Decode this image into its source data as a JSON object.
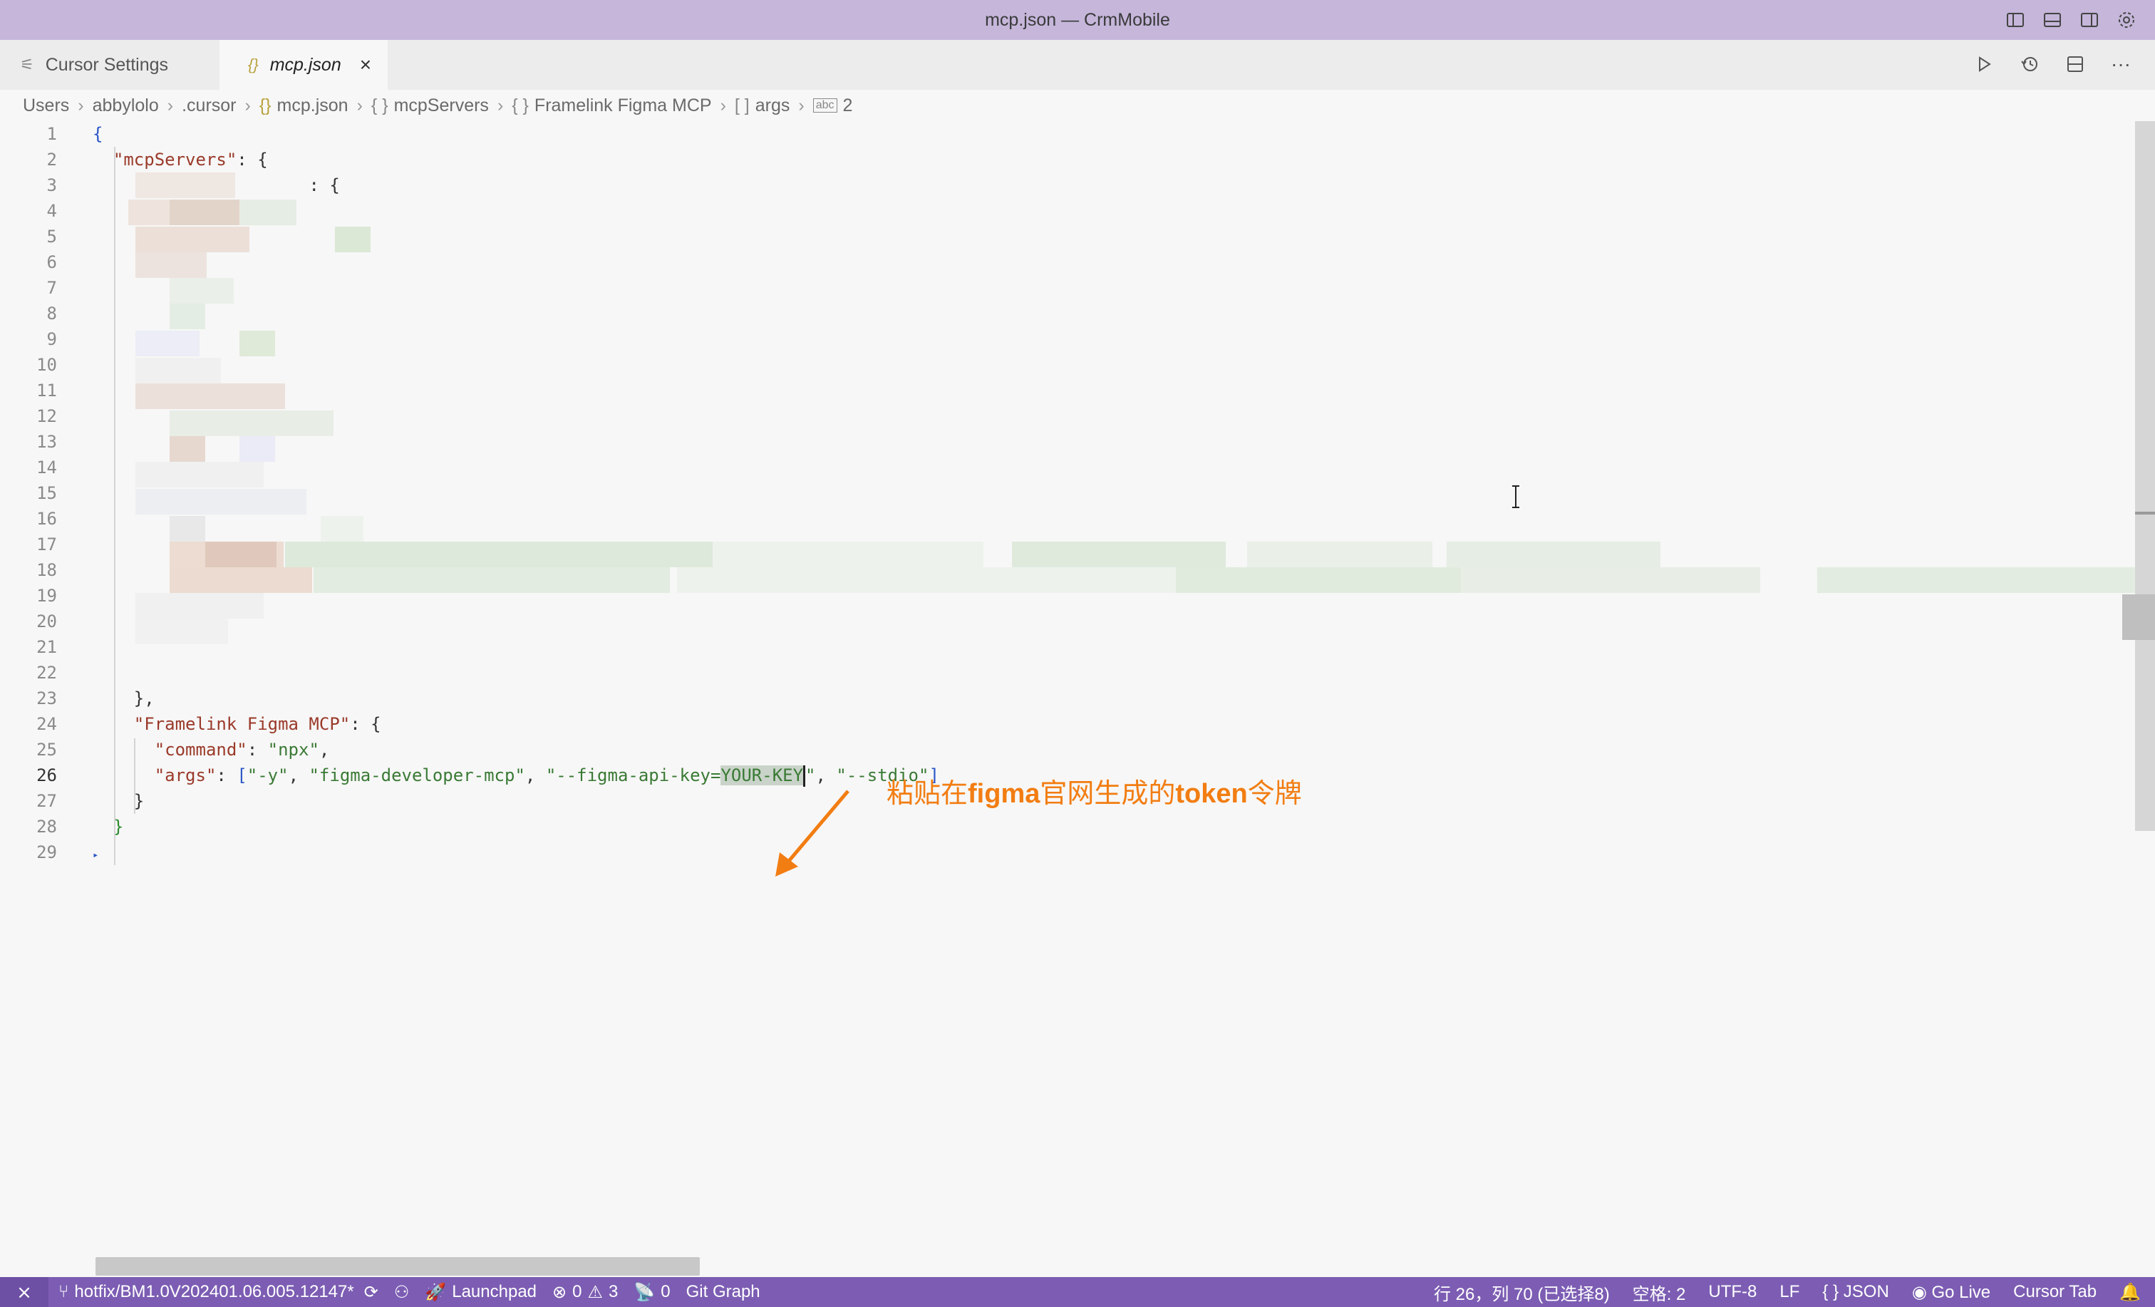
{
  "window": {
    "title": "mcp.json — CrmMobile"
  },
  "titlebar_icons": [
    "toggle-primary-sidebar-icon",
    "toggle-panel-icon",
    "toggle-secondary-sidebar-icon",
    "settings-gear-icon"
  ],
  "tabs": [
    {
      "label": "Cursor Settings",
      "icon": "settings-sliders-icon",
      "active": false
    },
    {
      "label": "mcp.json",
      "icon": "json-braces-icon",
      "active": true
    }
  ],
  "tab_actions": [
    "run-icon",
    "timeline-history-icon",
    "split-editor-icon",
    "more-icon"
  ],
  "breadcrumb": {
    "items": [
      "Users",
      "abbylolo",
      ".cursor",
      "mcp.json",
      "mcpServers",
      "Framelink Figma MCP",
      "args",
      "2"
    ],
    "icons": {
      "mcp.json": "{}",
      "mcpServers": "{ }",
      "Framelink Figma MCP": "{ }",
      "args": "[ ]",
      "2": "abc"
    }
  },
  "editor": {
    "line_numbers": [
      "1",
      "2",
      "3",
      "4",
      "5",
      "6",
      "7",
      "8",
      "9",
      "10",
      "11",
      "12",
      "13",
      "14",
      "15",
      "16",
      "17",
      "18",
      "19",
      "20",
      "21",
      "22",
      "23",
      "24",
      "25",
      "26",
      "27",
      "28",
      "29"
    ],
    "current_line": "26",
    "lines": {
      "l1": "{",
      "l2_key": "\"mcpServers\"",
      "l2_rest": ": {",
      "l3_tail": ": {",
      "l23": "},",
      "l24_key": "\"Framelink Figma MCP\"",
      "l24_rest": ": {",
      "l25_key": "\"command\"",
      "l25_sep": ": ",
      "l25_val": "\"npx\"",
      "l25_comma": ",",
      "l26_key": "\"args\"",
      "l26_sep": ": ",
      "l26_open": "[",
      "l26_a1": "\"-y\"",
      "l26_c1": ", ",
      "l26_a2": "\"figma-developer-mcp\"",
      "l26_c2": ", ",
      "l26_a3_pre": "\"--figma-api-key=",
      "l26_a3_sel": "YOUR-KEY",
      "l26_a3_post": "\"",
      "l26_c3": ", ",
      "l26_a4": "\"--stdio\"",
      "l26_close": "]",
      "l27": "}",
      "l28": "}"
    }
  },
  "annotation": {
    "pre": "粘贴在",
    "bold1": "figma",
    "mid": "官网生成的",
    "bold2": "token",
    "post": "令牌"
  },
  "statusbar": {
    "branch": "hotfix/BM1.0V202401.06.005.12147*",
    "launchpad": "Launchpad",
    "errors": "0",
    "warnings": "3",
    "ports": "0",
    "git_graph": "Git Graph",
    "position": "行 26，列 70 (已选择8)",
    "spaces": "空格: 2",
    "encoding": "UTF-8",
    "eol": "LF",
    "language": "JSON",
    "go_live": "Go Live",
    "cursor_tab": "Cursor Tab"
  }
}
